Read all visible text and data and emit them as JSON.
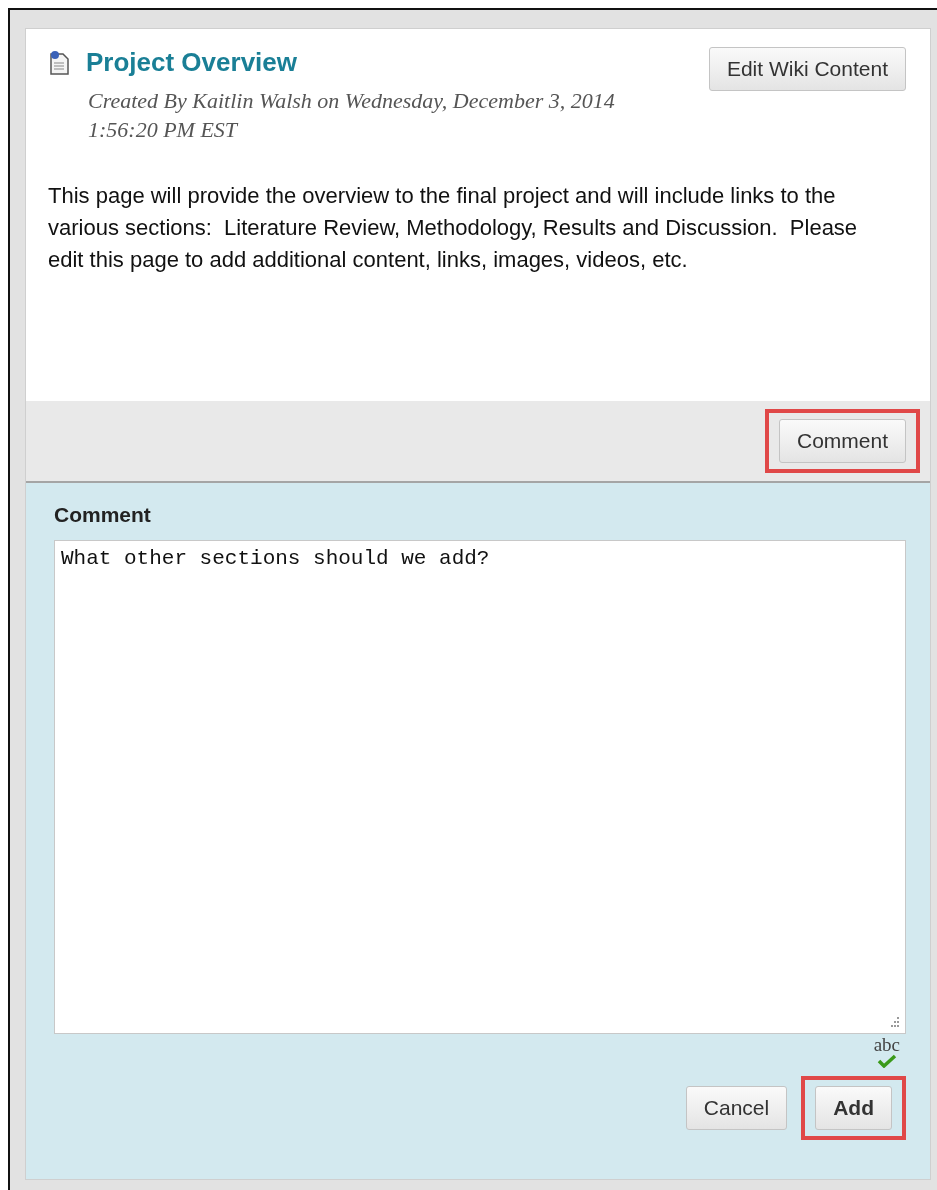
{
  "page": {
    "title": "Project Overview",
    "created": "Created By Kaitlin Walsh on Wednesday, December 3, 2014 1:56:20 PM EST",
    "edit_button": {
      "label": "Edit Wiki Content",
      "highlighted": false
    },
    "body": "This page will provide the overview to the final project and will include links to the various sections:  Literature Review, Methodology, Results and Discussion.  Please edit this page to add additional content, links, images, videos, etc."
  },
  "comment_bar": {
    "button": {
      "label": "Comment",
      "highlighted": true
    }
  },
  "comment_form": {
    "label": "Comment",
    "value": "What other sections should we add?",
    "spellcheck": "abc",
    "buttons": [
      {
        "label": "Cancel",
        "highlighted": false,
        "primary": false
      },
      {
        "label": "Add",
        "highlighted": true,
        "primary": true
      }
    ]
  }
}
